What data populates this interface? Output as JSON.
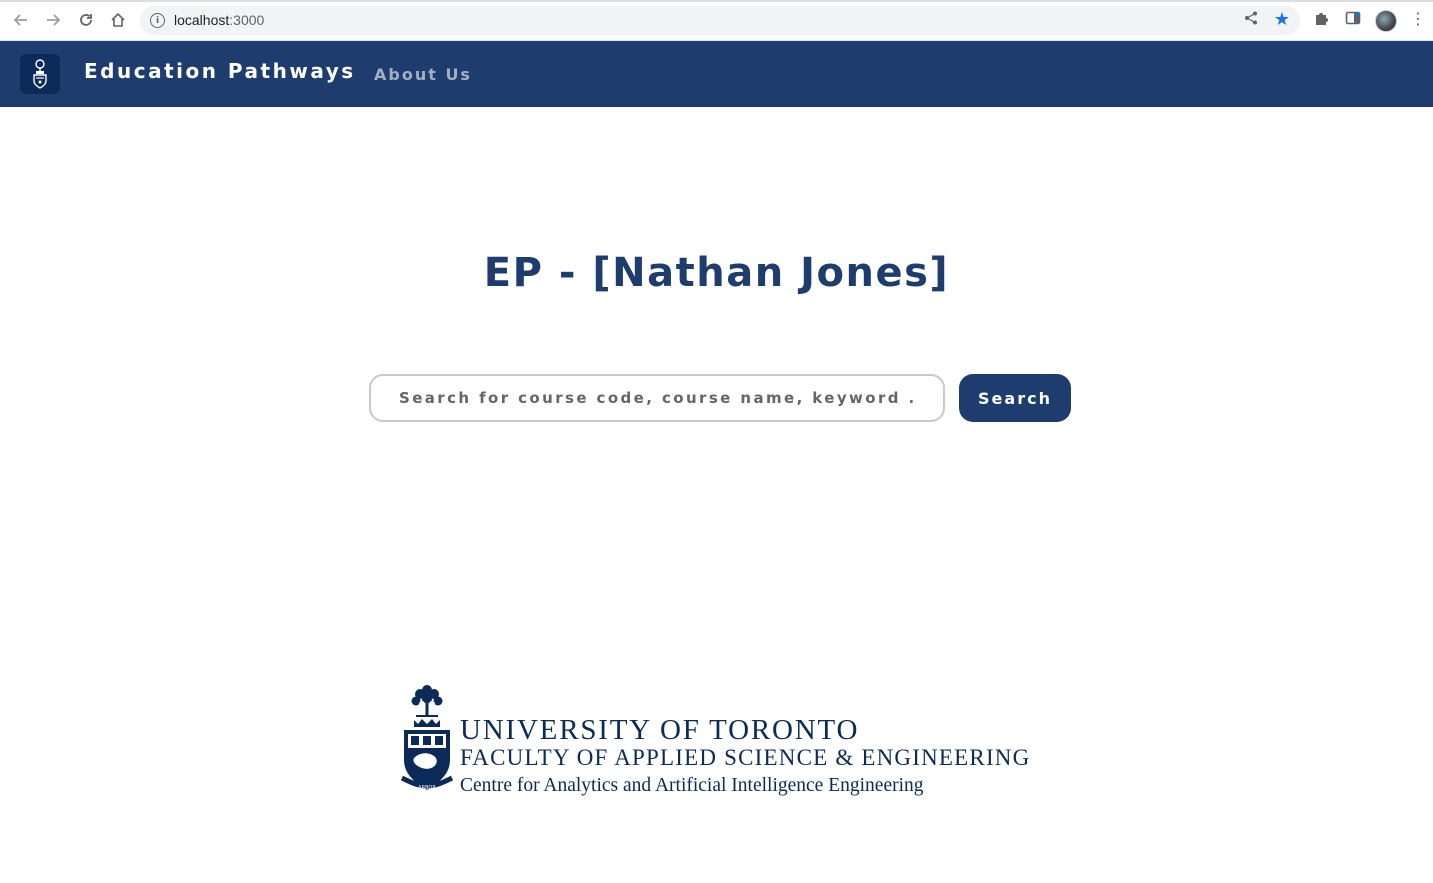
{
  "browser": {
    "url_host": "localhost",
    "url_port": ":3000",
    "icons": [
      "back-arrow-icon",
      "forward-arrow-icon",
      "reload-icon",
      "home-icon",
      "site-info-icon",
      "share-icon",
      "bookmark-star-icon",
      "extensions-icon",
      "side-panel-icon",
      "profile-avatar",
      "more-menu-icon"
    ]
  },
  "navbar": {
    "brand": "Education Pathways",
    "links": [
      {
        "label": "About Us"
      }
    ],
    "bg_color": "#1e3d6e"
  },
  "main": {
    "title": "EP - [Nathan Jones]",
    "search": {
      "placeholder": "Search for course code, course name, keyword ...",
      "value": "",
      "button_label": "Search"
    }
  },
  "footer": {
    "line1": "UNIVERSITY OF TORONTO",
    "line2": "FACULTY OF APPLIED SCIENCE & ENGINEERING",
    "line3": "Centre for Analytics and Artificial Intelligence Engineering",
    "crest_text": "ARBOR"
  },
  "colors": {
    "primary": "#1e3d6e",
    "footer_text": "#0b2a57",
    "nav_link": "#a3afc4",
    "bookmark": "#1a73e8"
  }
}
